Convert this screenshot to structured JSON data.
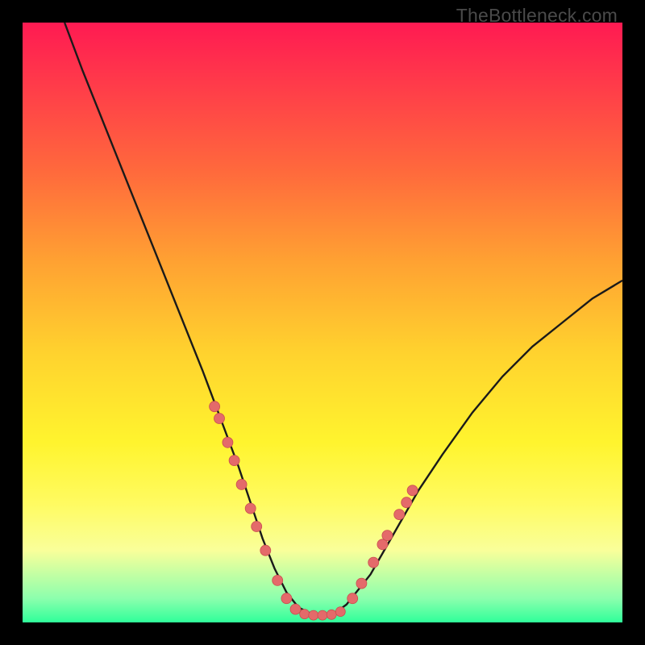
{
  "watermark": "TheBottleneck.com",
  "colors": {
    "curve_stroke": "#1a1a1a",
    "marker_fill": "#e46a6a",
    "marker_stroke": "#c94f4f"
  },
  "chart_data": {
    "type": "line",
    "title": "",
    "xlabel": "",
    "ylabel": "",
    "xlim": [
      0,
      100
    ],
    "ylim": [
      0,
      100
    ],
    "series": [
      {
        "name": "bottleneck-curve",
        "x": [
          7,
          10,
          14,
          18,
          22,
          26,
          30,
          33,
          36,
          38,
          40,
          42,
          44,
          46,
          48,
          50,
          52,
          54,
          58,
          62,
          66,
          70,
          75,
          80,
          85,
          90,
          95,
          100
        ],
        "y": [
          100,
          92,
          82,
          72,
          62,
          52,
          42,
          34,
          26,
          20,
          14,
          9,
          5,
          2.5,
          1.5,
          1.2,
          1.5,
          3,
          8,
          15,
          22,
          28,
          35,
          41,
          46,
          50,
          54,
          57
        ]
      }
    ],
    "markers_left": [
      {
        "x": 32.0,
        "y": 36
      },
      {
        "x": 32.8,
        "y": 34
      },
      {
        "x": 34.2,
        "y": 30
      },
      {
        "x": 35.3,
        "y": 27
      },
      {
        "x": 36.5,
        "y": 23
      },
      {
        "x": 38.0,
        "y": 19
      },
      {
        "x": 39.0,
        "y": 16
      },
      {
        "x": 40.5,
        "y": 12
      },
      {
        "x": 42.5,
        "y": 7
      },
      {
        "x": 44.0,
        "y": 4
      },
      {
        "x": 45.5,
        "y": 2.2
      }
    ],
    "markers_bottom": [
      {
        "x": 47.0,
        "y": 1.4
      },
      {
        "x": 48.5,
        "y": 1.2
      },
      {
        "x": 50.0,
        "y": 1.2
      },
      {
        "x": 51.5,
        "y": 1.3
      },
      {
        "x": 53.0,
        "y": 1.8
      }
    ],
    "markers_right": [
      {
        "x": 55.0,
        "y": 4
      },
      {
        "x": 56.5,
        "y": 6.5
      },
      {
        "x": 58.5,
        "y": 10
      },
      {
        "x": 60.0,
        "y": 13
      },
      {
        "x": 60.8,
        "y": 14.5
      },
      {
        "x": 62.8,
        "y": 18
      },
      {
        "x": 64.0,
        "y": 20
      },
      {
        "x": 65.0,
        "y": 22
      }
    ]
  }
}
